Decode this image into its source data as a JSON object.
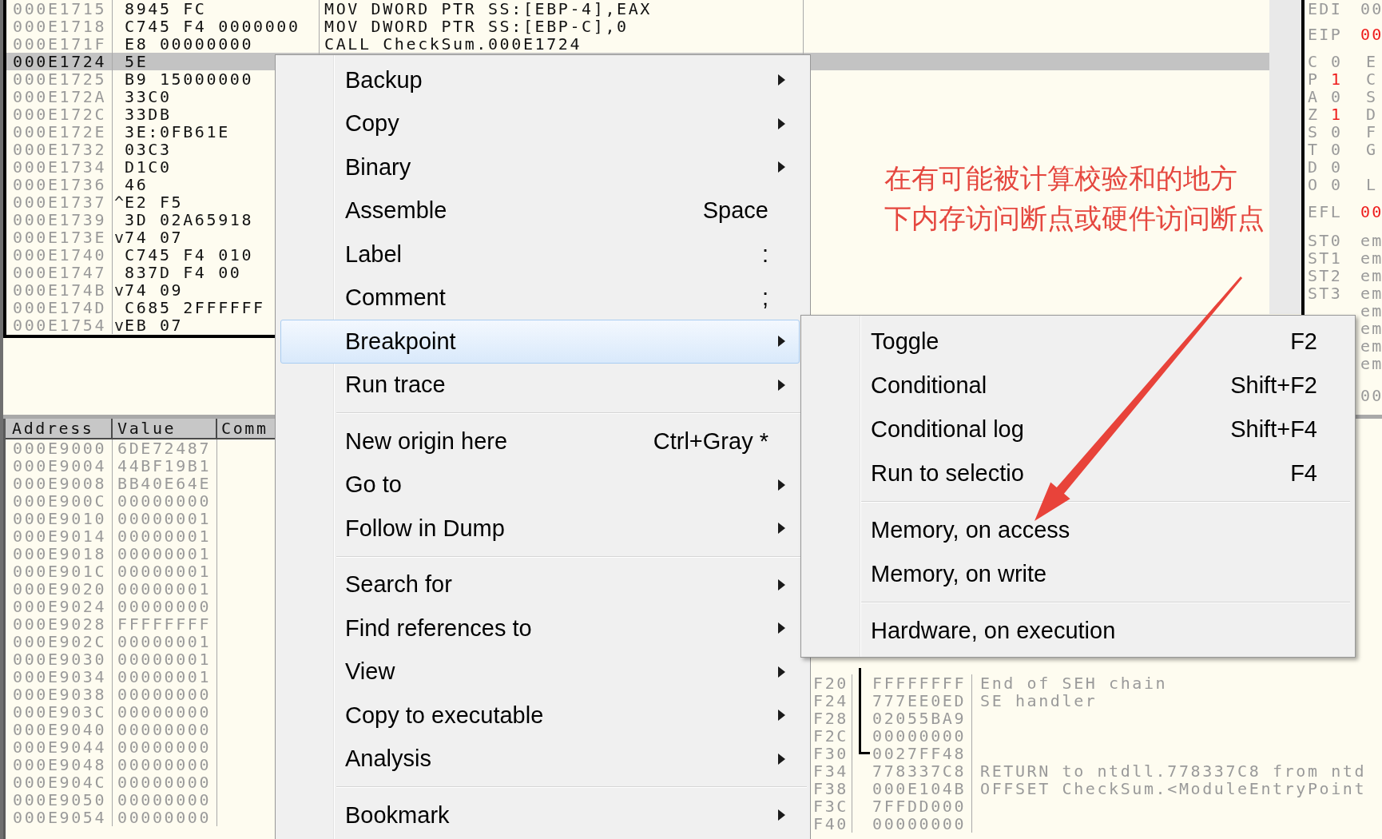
{
  "disassembly": {
    "rows": [
      {
        "address": "000E1715",
        "hex": "8945 FC",
        "command": "MOV DWORD PTR SS:[EBP-4],EAX",
        "selected": false
      },
      {
        "address": "000E1718",
        "hex": "C745 F4 0000000",
        "command": "MOV DWORD PTR SS:[EBP-C],0",
        "selected": false
      },
      {
        "address": "000E171F",
        "hex": "E8 00000000",
        "command": "CALL CheckSum.000E1724",
        "selected": false
      },
      {
        "address": "000E1724",
        "hex": "5E",
        "selected": true
      },
      {
        "address": "000E1725",
        "hex": "B9 15000000",
        "selected": false
      },
      {
        "address": "000E172A",
        "hex": "33C0",
        "selected": false
      },
      {
        "address": "000E172C",
        "hex": "33DB",
        "selected": false
      },
      {
        "address": "000E172E",
        "hex": "3E:0FB61E",
        "selected": false
      },
      {
        "address": "000E1732",
        "hex": "03C3",
        "selected": false
      },
      {
        "address": "000E1734",
        "hex": "D1C0",
        "selected": false
      },
      {
        "address": "000E1736",
        "hex": "46",
        "selected": false
      },
      {
        "address": "000E1737",
        "marker": "^",
        "hex": "E2 F5",
        "selected": false
      },
      {
        "address": "000E1739",
        "hex": "3D 02A65918",
        "selected": false
      },
      {
        "address": "000E173E",
        "marker": "v",
        "hex": "74 07",
        "selected": false
      },
      {
        "address": "000E1740",
        "hex": "C745 F4 010",
        "selected": false
      },
      {
        "address": "000E1747",
        "hex": "837D F4 00",
        "selected": false
      },
      {
        "address": "000E174B",
        "marker": "v",
        "hex": "74 09",
        "selected": false
      },
      {
        "address": "000E174D",
        "hex": "C685 2FFFFFF",
        "selected": false
      },
      {
        "address": "000E1754",
        "marker": "v",
        "hex": "EB 07",
        "selected": false
      }
    ]
  },
  "registers": {
    "general": [
      {
        "name": "EDI",
        "value": "00",
        "changed": false
      },
      {
        "name": "EIP",
        "value": "00",
        "changed": true
      }
    ],
    "flags": [
      {
        "name": "C",
        "value": "0",
        "changed": false,
        "column_3": "E"
      },
      {
        "name": "P",
        "value": "1",
        "changed": true,
        "column_3": "C"
      },
      {
        "name": "A",
        "value": "0",
        "changed": false,
        "column_3": "S"
      },
      {
        "name": "Z",
        "value": "1",
        "changed": true,
        "column_3": "D"
      },
      {
        "name": "S",
        "value": "0",
        "changed": false,
        "column_3": "F"
      },
      {
        "name": "T",
        "value": "0",
        "changed": false,
        "column_3": "G"
      },
      {
        "name": "D",
        "value": "0",
        "changed": false
      },
      {
        "name": "O",
        "value": "0",
        "changed": false,
        "column_3": "L"
      }
    ],
    "efl": {
      "name": "EFL",
      "value": "00",
      "changed": true
    },
    "fpu": [
      {
        "name": "ST0",
        "value": "em"
      },
      {
        "name": "ST1",
        "value": "em"
      },
      {
        "name": "ST2",
        "value": "em"
      },
      {
        "name": "ST3",
        "value": "em"
      },
      {
        "value": "em"
      },
      {
        "value": "em"
      },
      {
        "value": "em"
      },
      {
        "value": "em"
      }
    ],
    "footer": "00"
  },
  "dump": {
    "columns": [
      "Address",
      "Value",
      "Comm"
    ],
    "rows": [
      {
        "address": "000E9000",
        "value": "6DE72487"
      },
      {
        "address": "000E9004",
        "value": "44BF19B1"
      },
      {
        "address": "000E9008",
        "value": "BB40E64E"
      },
      {
        "address": "000E900C",
        "value": "00000000"
      },
      {
        "address": "000E9010",
        "value": "00000001"
      },
      {
        "address": "000E9014",
        "value": "00000001"
      },
      {
        "address": "000E9018",
        "value": "00000001"
      },
      {
        "address": "000E901C",
        "value": "00000001"
      },
      {
        "address": "000E9020",
        "value": "00000001"
      },
      {
        "address": "000E9024",
        "value": "00000000"
      },
      {
        "address": "000E9028",
        "value": "FFFFFFFF"
      },
      {
        "address": "000E902C",
        "value": "00000001"
      },
      {
        "address": "000E9030",
        "value": "00000001"
      },
      {
        "address": "000E9034",
        "value": "00000001"
      },
      {
        "address": "000E9038",
        "value": "00000000"
      },
      {
        "address": "000E903C",
        "value": "00000000"
      },
      {
        "address": "000E9040",
        "value": "00000000"
      },
      {
        "address": "000E9044",
        "value": "00000000"
      },
      {
        "address": "000E9048",
        "value": "00000000"
      },
      {
        "address": "000E904C",
        "value": "00000000"
      },
      {
        "address": "000E9050",
        "value": "00000000"
      },
      {
        "address": "000E9054",
        "value": "00000000"
      }
    ]
  },
  "stack": {
    "rows": [
      {
        "address": "F20",
        "value": "FFFFFFFF",
        "comment": "End of SEH chain",
        "in_bracket": true
      },
      {
        "address": "F24",
        "value": "777EE0ED",
        "comment": "SE handler",
        "in_bracket": true
      },
      {
        "address": "F28",
        "value": "02055BA9",
        "in_bracket": true
      },
      {
        "address": "F2C",
        "value": "00000000",
        "in_bracket": true
      },
      {
        "address": "F30",
        "value": "0027FF48",
        "in_bracket": true
      },
      {
        "address": "F34",
        "value": "778337C8",
        "comment": "RETURN to ntdll.778337C8 from ntd",
        "in_bracket": false
      },
      {
        "address": "F38",
        "value": "000E104B",
        "comment": "OFFSET CheckSum.<ModuleEntryPoint",
        "in_bracket": false
      },
      {
        "address": "F3C",
        "value": "7FFDD000",
        "in_bracket": false
      },
      {
        "address": "F40",
        "value": "00000000",
        "in_bracket": false
      }
    ]
  },
  "context_menu": {
    "items": [
      {
        "kind": "item",
        "label": "Backup",
        "has_submenu": true,
        "selected": false
      },
      {
        "kind": "item",
        "label": "Copy",
        "has_submenu": true,
        "selected": false
      },
      {
        "kind": "item",
        "label": "Binary",
        "has_submenu": true,
        "selected": false
      },
      {
        "kind": "item",
        "label": "Assemble",
        "shortcut": "Space",
        "has_submenu": false,
        "selected": false
      },
      {
        "kind": "item",
        "label": "Label",
        "shortcut": ":",
        "has_submenu": false,
        "selected": false
      },
      {
        "kind": "item",
        "label": "Comment",
        "shortcut": ";",
        "has_submenu": false,
        "selected": false
      },
      {
        "kind": "item",
        "label": "Breakpoint",
        "has_submenu": true,
        "selected": true
      },
      {
        "kind": "item",
        "label": "Run trace",
        "has_submenu": true,
        "selected": false
      },
      {
        "kind": "separator"
      },
      {
        "kind": "item",
        "label": "New origin here",
        "shortcut": "Ctrl+Gray *",
        "has_submenu": false,
        "selected": false
      },
      {
        "kind": "item",
        "label": "Go to",
        "has_submenu": true,
        "selected": false
      },
      {
        "kind": "item",
        "label": "Follow in Dump",
        "has_submenu": true,
        "selected": false
      },
      {
        "kind": "separator"
      },
      {
        "kind": "item",
        "label": "Search for",
        "has_submenu": true,
        "selected": false
      },
      {
        "kind": "item",
        "label": "Find references to",
        "has_submenu": true,
        "selected": false
      },
      {
        "kind": "item",
        "label": "View",
        "has_submenu": true,
        "selected": false
      },
      {
        "kind": "item",
        "label": "Copy to executable",
        "has_submenu": true,
        "selected": false
      },
      {
        "kind": "item",
        "label": "Analysis",
        "has_submenu": true,
        "selected": false
      },
      {
        "kind": "separator"
      },
      {
        "kind": "item",
        "label": "Bookmark",
        "has_submenu": true,
        "selected": false
      }
    ]
  },
  "submenu": {
    "items": [
      {
        "kind": "item",
        "label": "Toggle",
        "shortcut": "F2",
        "selected": false
      },
      {
        "kind": "item",
        "label": "Conditional",
        "shortcut": "Shift+F2",
        "selected": false
      },
      {
        "kind": "item",
        "label": "Conditional log",
        "shortcut": "Shift+F4",
        "selected": false
      },
      {
        "kind": "item",
        "label": "Run to selectio",
        "shortcut": "F4",
        "selected": false
      },
      {
        "kind": "separator"
      },
      {
        "kind": "item",
        "label": "Memory, on access",
        "selected": false
      },
      {
        "kind": "item",
        "label": "Memory, on write",
        "selected": false
      },
      {
        "kind": "separator"
      },
      {
        "kind": "item",
        "label": "Hardware, on execution",
        "selected": false
      }
    ]
  },
  "annotation": {
    "lines": [
      "在有可能被计算校验和的地方",
      "下内存访问断点或硬件访问断点"
    ],
    "arrow": true
  }
}
